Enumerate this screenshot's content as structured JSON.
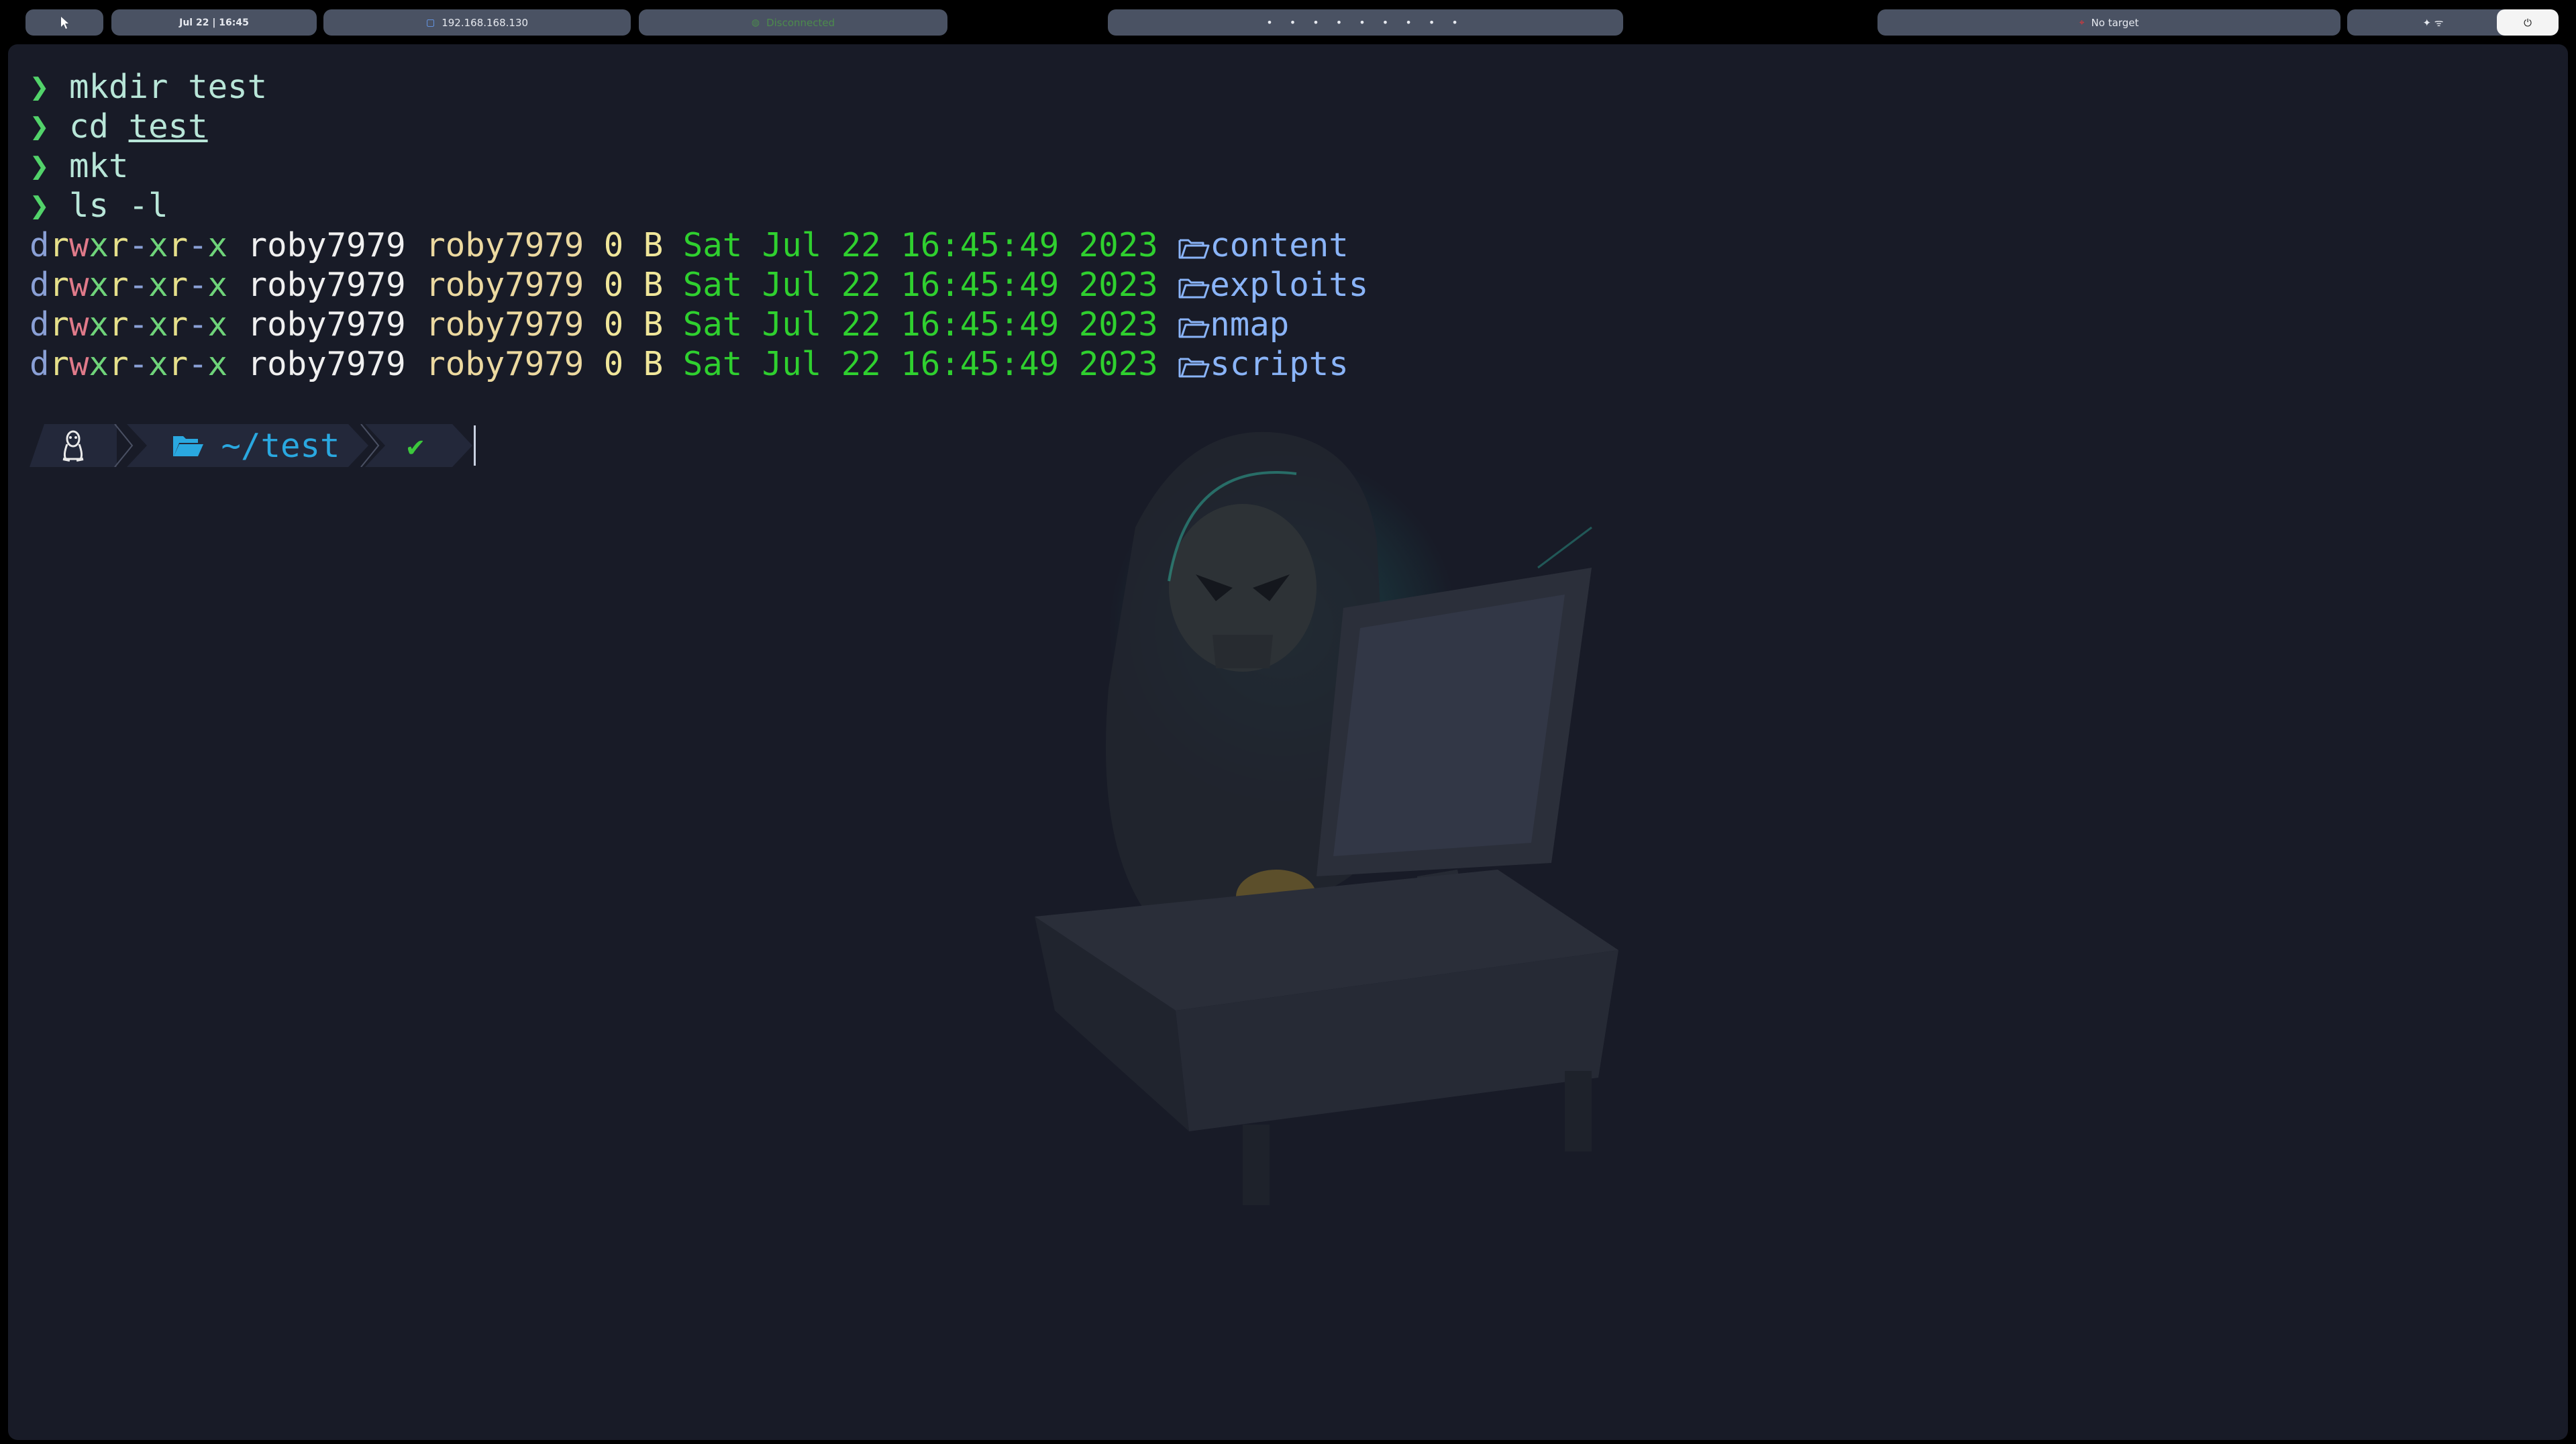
{
  "topbar": {
    "menu_icon": "pointer-icon",
    "clock": "Jul 22 | 16:45",
    "ip": "192.168.168.130",
    "vpn_status": "Disconnected",
    "workspaces": "• • • • • • • • •",
    "target": "No target",
    "system_icons": "✦  ᯤ",
    "power_icon": "⏻"
  },
  "terminal": {
    "history": [
      {
        "prompt": "❯",
        "command": "mkdir",
        "arg": "test"
      },
      {
        "prompt": "❯",
        "command": "cd",
        "arg": "test"
      },
      {
        "prompt": "❯",
        "command": "mkt",
        "arg": ""
      },
      {
        "prompt": "❯",
        "command": "ls",
        "arg": "-l"
      }
    ],
    "listing": [
      {
        "perms": "drwxr-xr-x",
        "owner": "roby7979",
        "group": "roby7979",
        "size": "0 B",
        "date": "Sat Jul 22 16:45:49 2023",
        "name": "content"
      },
      {
        "perms": "drwxr-xr-x",
        "owner": "roby7979",
        "group": "roby7979",
        "size": "0 B",
        "date": "Sat Jul 22 16:45:49 2023",
        "name": "exploits"
      },
      {
        "perms": "drwxr-xr-x",
        "owner": "roby7979",
        "group": "roby7979",
        "size": "0 B",
        "date": "Sat Jul 22 16:45:49 2023",
        "name": "nmap"
      },
      {
        "perms": "drwxr-xr-x",
        "owner": "roby7979",
        "group": "roby7979",
        "size": "0 B",
        "date": "Sat Jul 22 16:45:49 2023",
        "name": "scripts"
      }
    ],
    "prompt_line": {
      "os_icon": "linux-tux-icon",
      "dir": "~/test",
      "status": "✔"
    }
  },
  "colors": {
    "terminal_bg": "#181b27",
    "pill_bg": "#4a5263",
    "prompt_arrow": "#52d36a",
    "date": "#2fd02f",
    "dir_name": "#8ab4f8"
  }
}
